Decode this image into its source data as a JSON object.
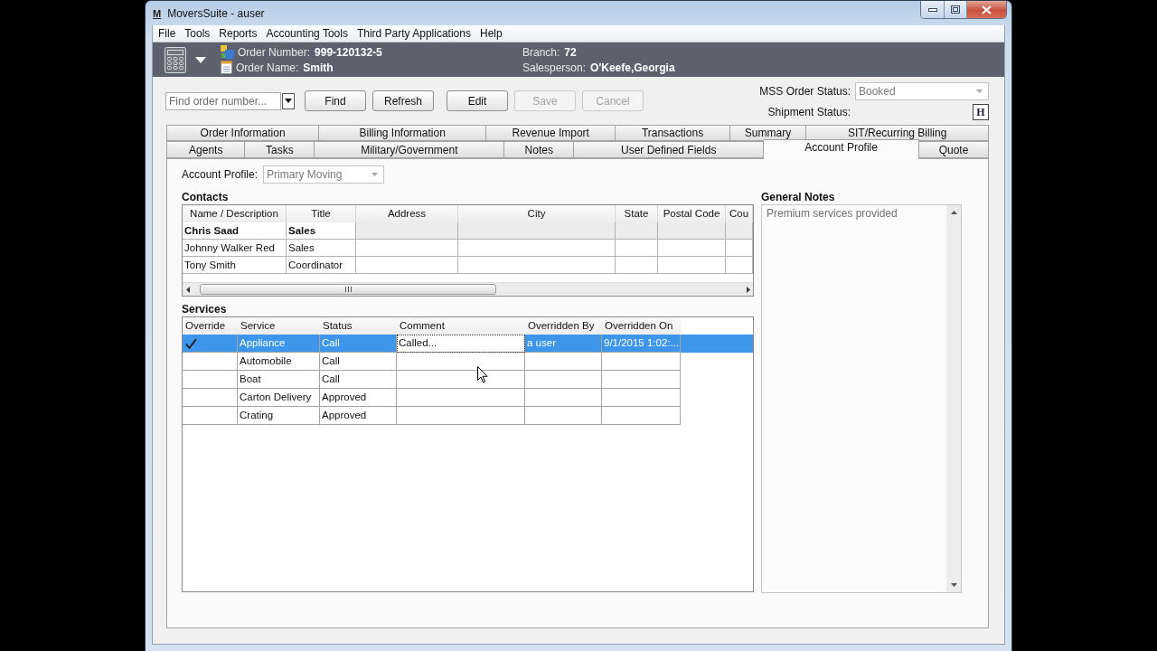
{
  "window": {
    "logo": "M",
    "title": "MoversSuite - auser"
  },
  "menu": [
    "File",
    "Tools",
    "Reports",
    "Accounting Tools",
    "Third Party Applications",
    "Help"
  ],
  "header": {
    "order_number": {
      "label": "Order Number:",
      "value": "999-120132-5"
    },
    "order_name": {
      "label": "Order Name:",
      "value": "Smith"
    },
    "branch": {
      "label": "Branch:",
      "value": "72"
    },
    "salesperson": {
      "label": "Salesperson:",
      "value": "O'Keefe,Georgia"
    }
  },
  "toolbar": {
    "search": {
      "placeholder": "Find order number..."
    },
    "search_buttons": [
      {
        "label": "Find",
        "disabled": false
      },
      {
        "label": "Refresh",
        "disabled": false
      }
    ],
    "edit_buttons": [
      {
        "label": "Edit",
        "disabled": false
      },
      {
        "label": "Save",
        "disabled": true
      },
      {
        "label": "Cancel",
        "disabled": true
      }
    ]
  },
  "order_status": {
    "label": "MSS Order Status:",
    "value": "Booked",
    "disabled": true
  },
  "shipment_status": {
    "label": "Shipment Status:",
    "button": "H"
  },
  "tab_rows": [
    {
      "tabs": [
        {
          "label": "Order Information",
          "selected": false
        },
        {
          "label": "Billing Information",
          "selected": false
        },
        {
          "label": "Revenue Import",
          "selected": false
        },
        {
          "label": "Transactions",
          "selected": false
        },
        {
          "label": "Summary",
          "selected": false
        },
        {
          "label": "SIT/Recurring Billing",
          "selected": false
        }
      ]
    },
    {
      "tabs": [
        {
          "label": "Agents",
          "selected": false
        },
        {
          "label": "Tasks",
          "selected": false
        },
        {
          "label": "Military/Government",
          "selected": false
        },
        {
          "label": "Notes",
          "selected": false
        },
        {
          "label": "User Defined Fields",
          "selected": false
        },
        {
          "label": "Account Profile",
          "selected": true
        },
        {
          "label": "Quote",
          "selected": false
        }
      ]
    }
  ],
  "account_profile": {
    "label": "Account Profile:",
    "value": "Primary Moving",
    "disabled": true
  },
  "contacts": {
    "title": "Contacts",
    "columns": [
      "Name / Description",
      "Title",
      "Address",
      "City",
      "State",
      "Postal Code",
      "Cou"
    ],
    "rows": [
      {
        "name": "Chris Saad",
        "title": "Sales",
        "primary": true
      },
      {
        "name": "Johnny Walker Red",
        "title": "Sales",
        "primary": false
      },
      {
        "name": "Tony Smith",
        "title": "Coordinator",
        "primary": false
      }
    ]
  },
  "services": {
    "title": "Services",
    "columns": [
      "Override",
      "Service",
      "Status",
      "Comment",
      "Overridden By",
      "Overridden On"
    ],
    "rows": [
      {
        "override": true,
        "selected": true,
        "service": "Appliance",
        "status": "Call",
        "comment": "Called...",
        "overridden_by": "a user",
        "overridden_on": "9/1/2015 1:02:..."
      },
      {
        "override": false,
        "selected": false,
        "service": "Automobile",
        "status": "Call"
      },
      {
        "override": false,
        "selected": false,
        "service": "Boat",
        "status": "Call"
      },
      {
        "override": false,
        "selected": false,
        "service": "Carton Delivery",
        "status": "Approved"
      },
      {
        "override": false,
        "selected": false,
        "service": "Crating",
        "status": "Approved"
      }
    ]
  },
  "general_notes": {
    "title": "General Notes",
    "text": "Premium services provided"
  }
}
